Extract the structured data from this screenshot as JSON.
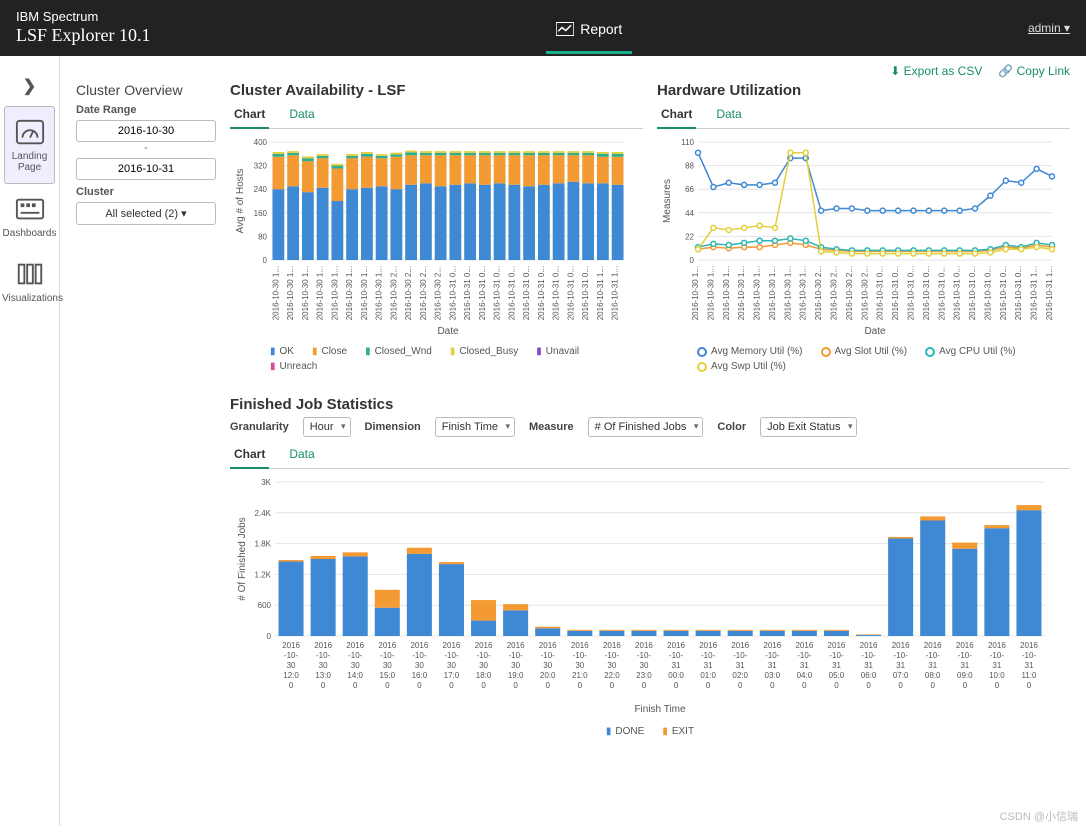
{
  "header": {
    "brand_top": "IBM Spectrum",
    "brand_sub": "LSF Explorer 10.1",
    "report": "Report",
    "user": "admin",
    "caret": "▾"
  },
  "sidebar": {
    "collapse": "❯",
    "items": [
      "Landing Page",
      "Dashboards",
      "Visualizations"
    ]
  },
  "actions": {
    "export": "⬇ Export as CSV",
    "copy": "🔗 Copy Link"
  },
  "overview": {
    "title": "Cluster Overview",
    "date_label": "Date Range",
    "date_from": "2016-10-30",
    "date_sep": "-",
    "date_to": "2016-10-31",
    "cluster_label": "Cluster",
    "cluster_sel": "All selected (2) ▾"
  },
  "availability": {
    "title": "Cluster Availability - LSF",
    "tabs": {
      "chart": "Chart",
      "data": "Data"
    },
    "ylabel": "Avg # of Hosts",
    "xlabel": "Date",
    "legend": [
      "OK",
      "Close",
      "Closed_Wnd",
      "Closed_Busy",
      "Unavail",
      "Unreach"
    ]
  },
  "hardware": {
    "title": "Hardware Utilization",
    "tabs": {
      "chart": "Chart",
      "data": "Data"
    },
    "ylabel": "Measures",
    "xlabel": "Date",
    "legend": [
      "Avg Memory Util (%)",
      "Avg Slot Util (%)",
      "Avg CPU Util (%)",
      "Avg Swp Util (%)"
    ]
  },
  "finished": {
    "title": "Finished Job Statistics",
    "controls": {
      "gran_l": "Granularity",
      "gran_v": "Hour",
      "dim_l": "Dimension",
      "dim_v": "Finish Time",
      "meas_l": "Measure",
      "meas_v": "# Of Finished Jobs",
      "col_l": "Color",
      "col_v": "Job Exit Status"
    },
    "tabs": {
      "chart": "Chart",
      "data": "Data"
    },
    "ylabel": "# Of Finished Jobs",
    "xlabel": "Finish Time",
    "legend": [
      "DONE",
      "EXIT"
    ]
  },
  "watermark": "CSDN @小信瑞",
  "chart_data": {
    "availability": {
      "type": "bar",
      "ylim": [
        0,
        400
      ],
      "yticks": [
        0,
        80,
        160,
        240,
        320,
        400
      ],
      "x": [
        "2016-10-30 1...",
        "2016-10-30 1...",
        "2016-10-30 1...",
        "2016-10-30 1...",
        "2016-10-30 1...",
        "2016-10-30 1...",
        "2016-10-30 1...",
        "2016-10-30 1...",
        "2016-10-30 2...",
        "2016-10-30 2...",
        "2016-10-30 2...",
        "2016-10-30 2...",
        "2016-10-31 0...",
        "2016-10-31 0...",
        "2016-10-31 0...",
        "2016-10-31 0...",
        "2016-10-31 0...",
        "2016-10-31 0...",
        "2016-10-31 0...",
        "2016-10-31 0...",
        "2016-10-31 0...",
        "2016-10-31 0...",
        "2016-10-31 1...",
        "2016-10-31 1..."
      ],
      "series": [
        {
          "name": "OK",
          "color": "#3f88d4",
          "values": [
            240,
            250,
            230,
            245,
            200,
            240,
            245,
            250,
            240,
            255,
            260,
            250,
            255,
            260,
            255,
            260,
            255,
            250,
            255,
            260,
            265,
            260,
            260,
            255
          ]
        },
        {
          "name": "Close",
          "color": "#f39a33",
          "values": [
            110,
            105,
            105,
            100,
            110,
            105,
            105,
            95,
            110,
            100,
            95,
            105,
            100,
            95,
            100,
            95,
            100,
            105,
            100,
            95,
            90,
            95,
            90,
            95
          ]
        },
        {
          "name": "Closed_Wnd",
          "color": "#2fae8e",
          "values": [
            10,
            8,
            10,
            8,
            10,
            8,
            10,
            8,
            8,
            10,
            8,
            8,
            8,
            8,
            8,
            8,
            8,
            8,
            8,
            8,
            8,
            8,
            10,
            10
          ]
        },
        {
          "name": "Closed_Busy",
          "color": "#e4cf3a",
          "values": [
            6,
            6,
            6,
            6,
            6,
            6,
            6,
            6,
            6,
            6,
            6,
            6,
            6,
            6,
            6,
            6,
            6,
            6,
            6,
            6,
            6,
            6,
            6,
            6
          ]
        },
        {
          "name": "Unavail",
          "color": "#8c48c4",
          "values": [
            0,
            0,
            0,
            0,
            0,
            0,
            0,
            0,
            0,
            0,
            0,
            0,
            0,
            0,
            0,
            0,
            0,
            0,
            0,
            0,
            0,
            0,
            0,
            0
          ]
        },
        {
          "name": "Unreach",
          "color": "#d64f9e",
          "values": [
            0,
            0,
            0,
            0,
            0,
            0,
            0,
            0,
            0,
            0,
            0,
            0,
            0,
            0,
            0,
            0,
            0,
            0,
            0,
            0,
            0,
            0,
            0,
            0
          ]
        }
      ]
    },
    "hardware": {
      "type": "line",
      "ylim": [
        0,
        110
      ],
      "yticks": [
        0,
        22,
        44,
        66,
        88,
        110
      ],
      "x": [
        "2016-10-30 1...",
        "2016-10-30 1...",
        "2016-10-30 1...",
        "2016-10-30 1...",
        "2016-10-30 1...",
        "2016-10-30 1...",
        "2016-10-30 1...",
        "2016-10-30 1...",
        "2016-10-30 2...",
        "2016-10-30 2...",
        "2016-10-30 2...",
        "2016-10-30 2...",
        "2016-10-31 0...",
        "2016-10-31 0...",
        "2016-10-31 0...",
        "2016-10-31 0...",
        "2016-10-31 0...",
        "2016-10-31 0...",
        "2016-10-31 0...",
        "2016-10-31 0...",
        "2016-10-31 0...",
        "2016-10-31 0...",
        "2016-10-31 1...",
        "2016-10-31 1..."
      ],
      "series": [
        {
          "name": "Avg Memory Util (%)",
          "color": "#3f88d4",
          "values": [
            100,
            68,
            72,
            70,
            70,
            72,
            95,
            95,
            46,
            48,
            48,
            46,
            46,
            46,
            46,
            46,
            46,
            46,
            48,
            60,
            74,
            72,
            85,
            78
          ]
        },
        {
          "name": "Avg Slot Util (%)",
          "color": "#f39a33",
          "values": [
            10,
            12,
            11,
            12,
            12,
            14,
            16,
            14,
            10,
            9,
            8,
            8,
            8,
            8,
            8,
            8,
            8,
            8,
            8,
            9,
            12,
            11,
            14,
            12
          ]
        },
        {
          "name": "Avg CPU Util (%)",
          "color": "#2fb4b4",
          "values": [
            12,
            15,
            14,
            16,
            18,
            18,
            20,
            18,
            12,
            10,
            9,
            9,
            9,
            9,
            9,
            9,
            9,
            9,
            9,
            10,
            14,
            12,
            16,
            14
          ]
        },
        {
          "name": "Avg Swp Util (%)",
          "color": "#e4cf3a",
          "values": [
            10,
            30,
            28,
            30,
            32,
            30,
            100,
            100,
            8,
            7,
            6,
            6,
            6,
            6,
            6,
            6,
            6,
            6,
            6,
            7,
            10,
            10,
            12,
            10
          ]
        }
      ]
    },
    "finished": {
      "type": "bar",
      "ylim": [
        0,
        3000
      ],
      "yticks_l": [
        "0",
        "600",
        "1.2K",
        "1.8K",
        "2.4K",
        "3K"
      ],
      "yticks": [
        0,
        600,
        1200,
        1800,
        2400,
        3000
      ],
      "x": [
        "2016-10-30 12:00",
        "2016-10-30 13:00",
        "2016-10-30 14:00",
        "2016-10-30 15:00",
        "2016-10-30 16:00",
        "2016-10-30 17:00",
        "2016-10-30 18:00",
        "2016-10-30 19:00",
        "2016-10-30 20:00",
        "2016-10-30 21:00",
        "2016-10-30 22:00",
        "2016-10-30 23:00",
        "2016-10-31 00:00",
        "2016-10-31 01:00",
        "2016-10-31 02:00",
        "2016-10-31 03:00",
        "2016-10-31 04:00",
        "2016-10-31 05:00",
        "2016-10-31 06:00",
        "2016-10-31 07:00",
        "2016-10-31 08:00",
        "2016-10-31 09:00",
        "2016-10-31 10:00",
        "2016-10-31 11:00"
      ],
      "x_display": [
        "2016\n-10-\n30\n12:0\n0",
        "2016\n-10-\n30\n13:0\n0",
        "2016\n-10-\n30\n14:0\n0",
        "2016\n-10-\n30\n15:0\n0",
        "2016\n-10-\n30\n16:0\n0",
        "2016\n-10-\n30\n17:0\n0",
        "2016\n-10-\n30\n18:0\n0",
        "2016\n-10-\n30\n19:0\n0",
        "2016\n-10-\n30\n20:0\n0",
        "2016\n-10-\n30\n21:0\n0",
        "2016\n-10-\n30\n22:0\n0",
        "2016\n-10-\n30\n23:0\n0",
        "2016\n-10-\n31\n00:0\n0",
        "2016\n-10-\n31\n01:0\n0",
        "2016\n-10-\n31\n02:0\n0",
        "2016\n-10-\n31\n03:0\n0",
        "2016\n-10-\n31\n04:0\n0",
        "2016\n-10-\n31\n05:0\n0",
        "2016\n-10-\n31\n06:0\n0",
        "2016\n-10-\n31\n07:0\n0",
        "2016\n-10-\n31\n08:0\n0",
        "2016\n-10-\n31\n09:0\n0",
        "2016\n-10-\n31\n10:0\n0",
        "2016\n-10-\n31\n11:0\n0"
      ],
      "series": [
        {
          "name": "DONE",
          "color": "#3f88d4",
          "values": [
            1450,
            1500,
            1550,
            550,
            1600,
            1400,
            300,
            500,
            150,
            100,
            100,
            100,
            100,
            100,
            100,
            100,
            100,
            100,
            20,
            1900,
            2250,
            1700,
            2100,
            2450
          ]
        },
        {
          "name": "EXIT",
          "color": "#f39a33",
          "values": [
            30,
            60,
            80,
            350,
            120,
            40,
            400,
            120,
            30,
            20,
            20,
            20,
            20,
            20,
            20,
            20,
            20,
            20,
            10,
            30,
            80,
            120,
            60,
            100
          ]
        }
      ]
    }
  }
}
